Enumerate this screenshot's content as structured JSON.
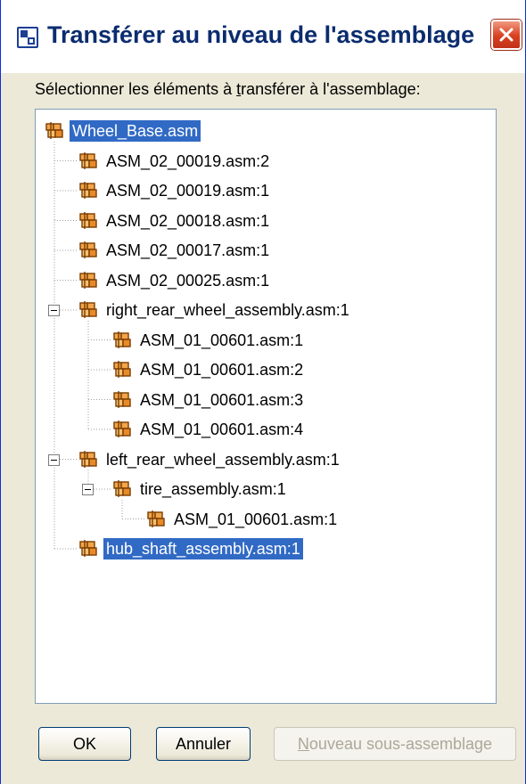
{
  "window": {
    "title": "Transférer au niveau de l'assemblage",
    "icon": "dialog-app-icon",
    "close_icon": "close-icon"
  },
  "instruction": {
    "before_u": "Sélectionner les éléments à ",
    "u": "t",
    "after_u": "ransférer à l'assemblage:"
  },
  "tree": {
    "node_icon": "assembly-icon",
    "selected_color": "#316ac5",
    "nodes": [
      {
        "label": "Wheel_Base.asm",
        "level": 0,
        "selected": true
      },
      {
        "label": "ASM_02_00019.asm:2",
        "level": 1
      },
      {
        "label": "ASM_02_00019.asm:1",
        "level": 1
      },
      {
        "label": "ASM_02_00018.asm:1",
        "level": 1
      },
      {
        "label": "ASM_02_00017.asm:1",
        "level": 1
      },
      {
        "label": "ASM_02_00025.asm:1",
        "level": 1
      },
      {
        "label": "right_rear_wheel_assembly.asm:1",
        "level": 1,
        "expanded": true
      },
      {
        "label": "ASM_01_00601.asm:1",
        "level": 2
      },
      {
        "label": "ASM_01_00601.asm:2",
        "level": 2
      },
      {
        "label": "ASM_01_00601.asm:3",
        "level": 2
      },
      {
        "label": "ASM_01_00601.asm:4",
        "level": 2
      },
      {
        "label": "left_rear_wheel_assembly.asm:1",
        "level": 1,
        "expanded": true
      },
      {
        "label": "tire_assembly.asm:1",
        "level": 2,
        "expanded": true
      },
      {
        "label": "ASM_01_00601.asm:1",
        "level": 3
      },
      {
        "label": "hub_shaft_assembly.asm:1",
        "level": 1,
        "selected": true
      }
    ]
  },
  "buttons": {
    "ok": "OK",
    "cancel": "Annuler",
    "new_sub_u": "N",
    "new_sub_rest": "ouveau sous-assemblage"
  }
}
